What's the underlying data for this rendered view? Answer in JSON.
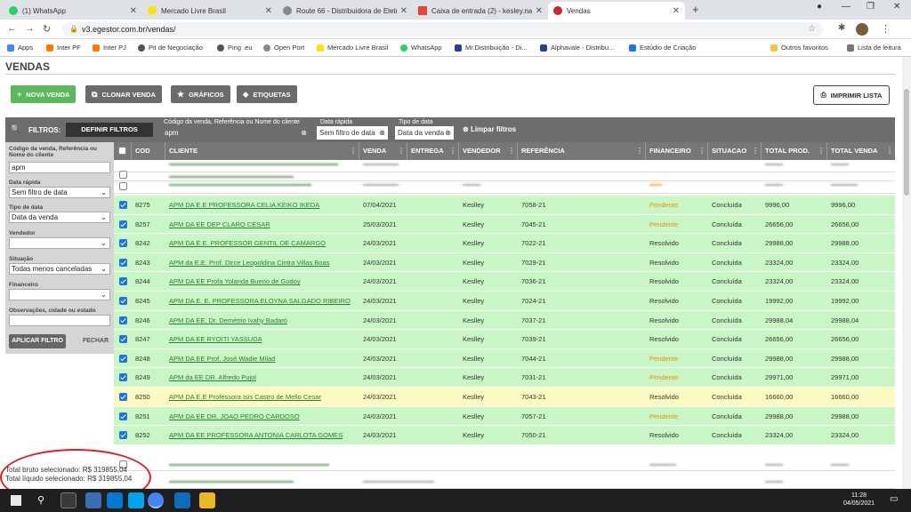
{
  "browser": {
    "tabs": [
      {
        "title": "(1) WhatsApp",
        "color": "#25d366"
      },
      {
        "title": "Mercado Livre Brasil",
        "color": "#ffe600"
      },
      {
        "title": "Route 66 - Distribuidora de Eletr",
        "color": "#888888"
      },
      {
        "title": "Caixa de entrada (2) - kesley.naz",
        "color": "#ea4335"
      },
      {
        "title": "Vendas",
        "color": "#c62828"
      }
    ],
    "new_tab": "+",
    "url": "v3.egestor.com.br/vendas/",
    "bookmarks": [
      "Apps",
      "Inter PF",
      "Inter PJ",
      "Pit de Negociação",
      "Ping .eu",
      "Open Port",
      "Mercado Livre Brasil",
      "WhatsApp",
      "Mr.Distribuição - Di...",
      "Alphavale - Distribu...",
      "Estúdio de Criação"
    ],
    "other_bookmarks": "Outros favoritos",
    "reading_list": "Lista de leitura"
  },
  "page": {
    "title": "VENDAS",
    "buttons": {
      "new_sale": "NOVA VENDA",
      "clone_sale": "CLONAR VENDA",
      "charts": "GRÁFICOS",
      "labels": "ETIQUETAS",
      "print": "IMPRIMIR LISTA"
    },
    "filterbar": {
      "label": "FILTROS:",
      "define": "DEFINIR FILTROS",
      "search_label": "Código da venda, Referência ou Nome do cliente",
      "search_value": "apm",
      "quick_date_label": "Data rápida",
      "quick_date_value": "Sem filtro de data",
      "date_type_label": "Tipo de data",
      "date_type_value": "Data da venda",
      "clear": "Limpar filtros"
    },
    "sidebar": {
      "search_label": "Código da venda, Referência ou Nome do cliente",
      "search_value": "apm",
      "quick_date_label": "Data rápida",
      "quick_date_value": "Sem filtro de data",
      "date_type_label": "Tipo de data",
      "date_type_value": "Data da venda",
      "seller_label": "Vendedor",
      "seller_value": "",
      "status_label": "Situação",
      "status_value": "Todas menos canceladas",
      "financial_label": "Financeiro",
      "financial_value": "",
      "notes_label": "Observações, cidade ou estado",
      "notes_value": "",
      "apply": "APLICAR FILTRO",
      "close": "FECHAR"
    },
    "columns": [
      "COD",
      "CLIENTE",
      "VENDA",
      "ENTREGA",
      "VENDEDOR",
      "REFERÊNCIA",
      "FINANCEIRO",
      "SITUACAO",
      "TOTAL PROD.",
      "TOTAL VENDA"
    ],
    "rows": [
      {
        "checked": true,
        "cod": "8275",
        "cliente": "APM DA E.E PROFESSORA CELIA KEIKO IKEDA",
        "venda": "07/04/2021",
        "entrega": "",
        "vendedor": "Keslley",
        "ref": "7058-21",
        "fin": "Pendente",
        "sit": "Concluída",
        "tprod": "9996,00",
        "tvenda": "9996,00",
        "color": "g"
      },
      {
        "checked": true,
        "cod": "8257",
        "cliente": "APM DA EE DEP CLARO CESAR",
        "venda": "25/03/2021",
        "entrega": "",
        "vendedor": "Keslley",
        "ref": "7045-21",
        "fin": "Pendente",
        "sit": "Concluída",
        "tprod": "26656,00",
        "tvenda": "26656,00",
        "color": "g"
      },
      {
        "checked": true,
        "cod": "8242",
        "cliente": "APM DA E.E. PROFESSOR GENTIL DE CAMARGO",
        "venda": "24/03/2021",
        "entrega": "",
        "vendedor": "Keslley",
        "ref": "7022-21",
        "fin": "Resolvido",
        "sit": "Concluída",
        "tprod": "29988,00",
        "tvenda": "29988,00",
        "color": "g"
      },
      {
        "checked": true,
        "cod": "8243",
        "cliente": "APM da E.E. Prof. Dirce Leopoldina Cintra Villas Boas",
        "venda": "24/03/2021",
        "entrega": "",
        "vendedor": "Keslley",
        "ref": "7029-21",
        "fin": "Resolvido",
        "sit": "Concluída",
        "tprod": "23324,00",
        "tvenda": "23324,00",
        "color": "g"
      },
      {
        "checked": true,
        "cod": "8244",
        "cliente": "APM DA EE Profa Yolanda Bueno de Godoy",
        "venda": "24/03/2021",
        "entrega": "",
        "vendedor": "Keslley",
        "ref": "7036-21",
        "fin": "Resolvido",
        "sit": "Concluída",
        "tprod": "23324,00",
        "tvenda": "23324,00",
        "color": "g"
      },
      {
        "checked": true,
        "cod": "8245",
        "cliente": "APM DA E. E. PROFESSORA ELOYNA SALGADO RIBEIRO",
        "venda": "24/03/2021",
        "entrega": "",
        "vendedor": "Keslley",
        "ref": "7024-21",
        "fin": "Resolvido",
        "sit": "Concluída",
        "tprod": "19992,00",
        "tvenda": "19992,00",
        "color": "g"
      },
      {
        "checked": true,
        "cod": "8246",
        "cliente": "APM DA EE. Dr. Demétrio Ivahy Badaró",
        "venda": "24/03/2021",
        "entrega": "",
        "vendedor": "Keslley",
        "ref": "7037-21",
        "fin": "Resolvido",
        "sit": "Concluída",
        "tprod": "29988,04",
        "tvenda": "29988,04",
        "color": "g"
      },
      {
        "checked": true,
        "cod": "8247",
        "cliente": "APM DA EE RYOITI YASSUDA",
        "venda": "24/03/2021",
        "entrega": "",
        "vendedor": "Keslley",
        "ref": "7039-21",
        "fin": "Resolvido",
        "sit": "Concluída",
        "tprod": "26656,00",
        "tvenda": "26656,00",
        "color": "g"
      },
      {
        "checked": true,
        "cod": "8248",
        "cliente": "APM DA EE Prof. José Wadie Milad",
        "venda": "24/03/2021",
        "entrega": "",
        "vendedor": "Keslley",
        "ref": "7044-21",
        "fin": "Pendente",
        "sit": "Concluída",
        "tprod": "29988,00",
        "tvenda": "29988,00",
        "color": "g"
      },
      {
        "checked": true,
        "cod": "8249",
        "cliente": "APM da EE DR. Alfredo Pujol",
        "venda": "24/03/2021",
        "entrega": "",
        "vendedor": "Keslley",
        "ref": "7031-21",
        "fin": "Pendente",
        "sit": "Concluída",
        "tprod": "29971,00",
        "tvenda": "29971,00",
        "color": "g"
      },
      {
        "checked": true,
        "cod": "8250",
        "cliente": "APM DA E.E Professora Isis Castro de Mello Cesar",
        "venda": "24/03/2021",
        "entrega": "",
        "vendedor": "Keslley",
        "ref": "7043-21",
        "fin": "Resolvido",
        "sit": "Concluída",
        "tprod": "16660,00",
        "tvenda": "16660,00",
        "color": "y"
      },
      {
        "checked": true,
        "cod": "8251",
        "cliente": "APM DA EE DR. JOAO PEDRO CARDOSO",
        "venda": "24/03/2021",
        "entrega": "",
        "vendedor": "Keslley",
        "ref": "7057-21",
        "fin": "Pendente",
        "sit": "Concluída",
        "tprod": "29988,00",
        "tvenda": "29988,00",
        "color": "g"
      },
      {
        "checked": true,
        "cod": "8252",
        "cliente": "APM DA EE PROFESSORA ANTONIA CARLOTA GOMES",
        "venda": "24/03/2021",
        "entrega": "",
        "vendedor": "Keslley",
        "ref": "7050-21",
        "fin": "Resolvido",
        "sit": "Concluída",
        "tprod": "23324,00",
        "tvenda": "23324,00",
        "color": "g"
      }
    ],
    "totals": {
      "gross": "Total bruto selecionado: R$ 319855,04",
      "net": "Total líquido selecionado: R$ 319855,04"
    }
  },
  "taskbar": {
    "time": "11:28",
    "date": "04/05/2021"
  },
  "colors": {
    "row_green": "#c8f7c5",
    "row_yellow": "#fcfac0",
    "pending": "#f08c00",
    "client_link": "#2e7d32",
    "btn_new": "#5cb85c",
    "btn_gray": "#6b6b6b",
    "highlight_circle": "#e02020"
  }
}
